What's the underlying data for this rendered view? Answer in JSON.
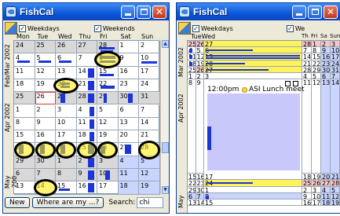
{
  "left": {
    "title": "FishCal",
    "weekdays_label": "Weekdays",
    "weekends_label": "Weekends",
    "days": [
      "Mon",
      "Tue",
      "Wed",
      "Thu",
      "Fri",
      "Sat",
      "Sun"
    ],
    "month_labels": [
      "Feb/Mar 2002",
      "Apr 2002",
      "May 200"
    ],
    "weeks": [
      [
        "24",
        "25",
        "26",
        "27",
        "28",
        "1",
        "2"
      ],
      [
        "4",
        "5",
        "6",
        "7",
        "8",
        "9",
        "10"
      ],
      [
        "11",
        "12",
        "13",
        "14",
        "15",
        "16",
        "17"
      ],
      [
        "18",
        "19",
        "20",
        "21",
        "22",
        "23",
        "24"
      ],
      [
        "25",
        "26",
        "27",
        "28",
        "29",
        "30",
        "31"
      ],
      [
        "1",
        "2",
        "3",
        "4",
        "5",
        "6",
        "7"
      ],
      [
        "8",
        "9",
        "10",
        "11",
        "12",
        "13",
        "14"
      ],
      [
        "15",
        "16",
        "17",
        "18",
        "19",
        "20",
        "21"
      ],
      [
        "22",
        "23",
        "24",
        "25",
        "26",
        "27",
        "28"
      ],
      [
        "29",
        "30",
        "1",
        "2",
        "3",
        "4",
        "5"
      ],
      [
        "6",
        "7",
        "8",
        "9",
        "10",
        "11",
        "12"
      ],
      [
        "13",
        "14",
        "15",
        "16",
        "17",
        "18",
        "19"
      ]
    ],
    "new_label": "New",
    "where_label": "Where are my ...?",
    "search_label": "Search:",
    "search_value": "chi"
  },
  "right": {
    "title": "FishCal",
    "weekdays_label": "Weekdays",
    "weekends_label": "We",
    "days_left": "TueWed",
    "days_right": [
      "Th",
      "Fri",
      "Sa",
      "Sun"
    ],
    "month_label_top": "Mar 2002",
    "month_label_bottom": "Apr 2002",
    "month_label_may": "May",
    "rows_left": [
      [
        "25",
        "26",
        "27"
      ],
      [
        "4",
        "5",
        "6"
      ],
      [
        "11",
        "12",
        "13"
      ],
      [
        "18",
        "19",
        "20"
      ],
      [
        "25",
        "26",
        "27"
      ],
      [
        "1",
        "2",
        "3"
      ],
      [
        "8",
        "9",
        "10"
      ]
    ],
    "rows_right": [
      [
        "28",
        "1",
        "2",
        "3"
      ],
      [
        "7",
        "8",
        "9",
        "10"
      ],
      [
        "14",
        "15",
        "16",
        "17"
      ],
      [
        "21",
        "22",
        "23",
        "24"
      ],
      [
        "28",
        "29",
        "30",
        "31"
      ],
      [
        "4",
        "5",
        "6",
        "7"
      ],
      [
        "11",
        "12",
        "13",
        "14"
      ]
    ],
    "rows_left_bottom": [
      [
        "15",
        "16",
        "17"
      ],
      [
        "22",
        "23",
        "24"
      ],
      [
        "29",
        "30",
        "1"
      ],
      [
        "6",
        "7",
        "8"
      ],
      [
        "13",
        "14",
        "15"
      ]
    ],
    "rows_right_bottom": [
      [
        "18",
        "19",
        "20",
        "21"
      ],
      [
        "25",
        "26",
        "27",
        "28"
      ],
      [
        "2",
        "3",
        "4",
        "5"
      ],
      [
        "9",
        "10",
        "11",
        "12"
      ],
      [
        "16",
        "17",
        "18",
        "19"
      ]
    ],
    "event_text": "12:00pm",
    "event_title": "ASI Lunch meet"
  }
}
